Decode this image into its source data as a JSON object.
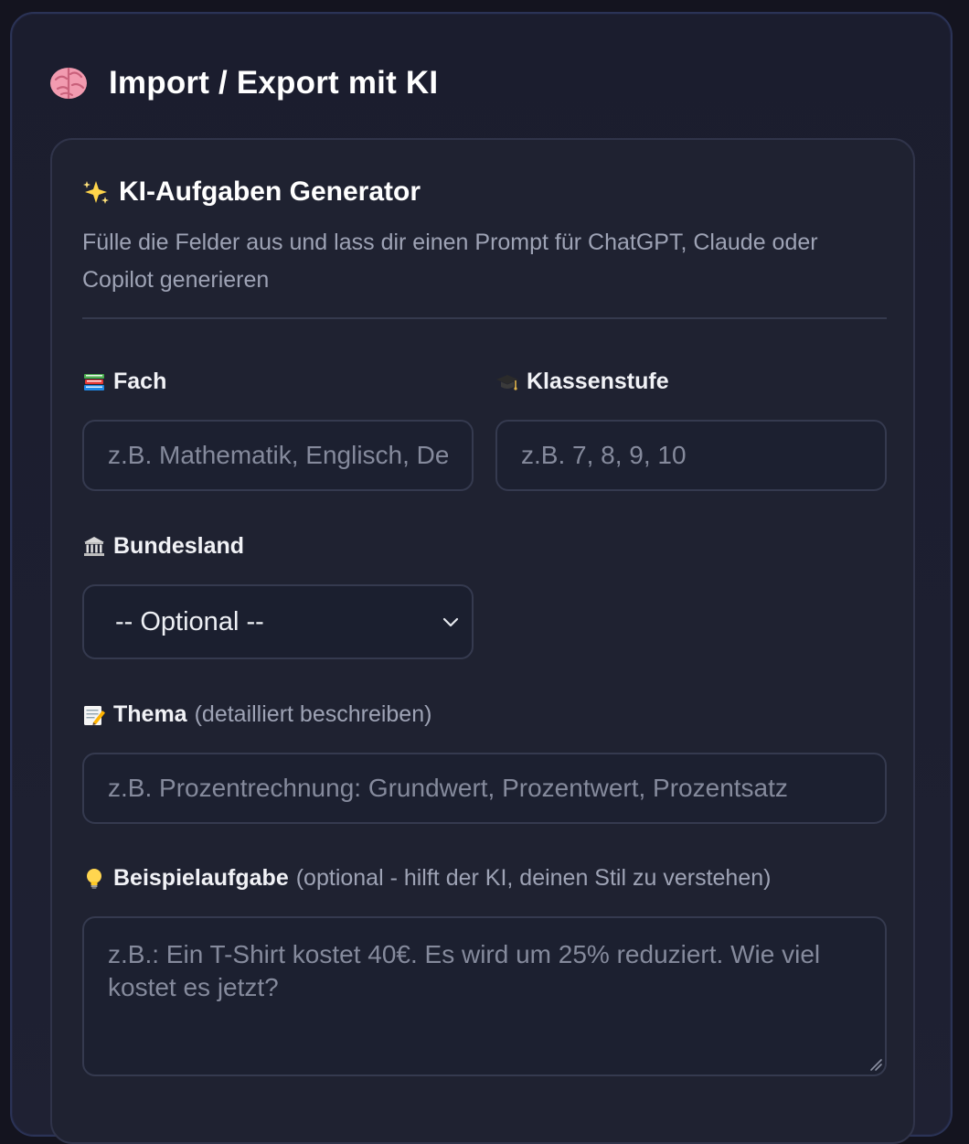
{
  "panel": {
    "title": "Import / Export mit KI",
    "icon": "brain-icon"
  },
  "generator": {
    "title": "KI-Aufgaben Generator",
    "icon": "sparkles-icon",
    "subtitle": "Fülle die Felder aus und lass dir einen Prompt für ChatGPT, Claude oder Copilot generieren"
  },
  "fields": {
    "fach": {
      "label": "Fach",
      "icon": "books-icon",
      "placeholder": "z.B. Mathematik, Englisch, Deutsch"
    },
    "klassenstufe": {
      "label": "Klassenstufe",
      "icon": "graduation-cap-icon",
      "placeholder": "z.B. 7, 8, 9, 10"
    },
    "bundesland": {
      "label": "Bundesland",
      "icon": "classical-building-icon",
      "selected": "-- Optional --"
    },
    "thema": {
      "label": "Thema",
      "hint": "(detailliert beschreiben)",
      "icon": "memo-icon",
      "placeholder": "z.B. Prozentrechnung: Grundwert, Prozentwert, Prozentsatz"
    },
    "beispiel": {
      "label": "Beispielaufgabe",
      "hint": "(optional - hilft der KI, deinen Stil zu verstehen)",
      "icon": "light-bulb-icon",
      "placeholder": "z.B.: Ein T-Shirt kostet 40€. Es wird um 25% reduziert. Wie viel kostet es jetzt?"
    }
  }
}
